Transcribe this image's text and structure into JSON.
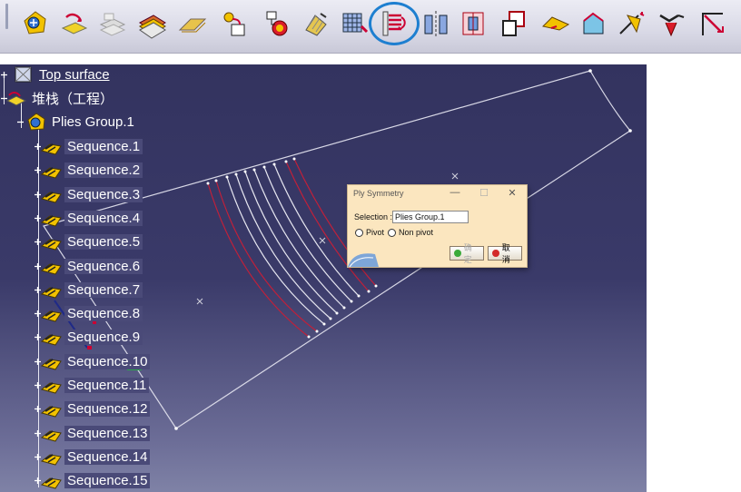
{
  "toolbar": {
    "icons": [
      "composites-param-icon",
      "stacking-icon",
      "grid-icon",
      "ply-table-icon",
      "surface-ply-icon",
      "link-ply-icon",
      "ply-exploder-icon",
      "plies-from-solid-icon",
      "core-grid-icon",
      "ply-symmetry-icon",
      "symmetry-axis-icon",
      "splice-icon",
      "cut-piece-icon",
      "flatten-icon",
      "material-excess-icon",
      "dart-icon",
      "check-icon",
      "corner-icon"
    ],
    "highlighted": "ply-symmetry-icon",
    "highlight_color": "#1e7fd0"
  },
  "tree": {
    "items": [
      {
        "label": "Top surface",
        "icon": "surface-icon"
      },
      {
        "label": "堆栈（工程）",
        "icon": "stacking-icon"
      },
      {
        "label": "Plies Group.1",
        "icon": "plies-group-icon"
      }
    ],
    "sequences": [
      "Sequence.1",
      "Sequence.2",
      "Sequence.3",
      "Sequence.4",
      "Sequence.5",
      "Sequence.6",
      "Sequence.7",
      "Sequence.8",
      "Sequence.9",
      "Sequence.10",
      "Sequence.11",
      "Sequence.12",
      "Sequence.13",
      "Sequence.14",
      "Sequence.15"
    ]
  },
  "dialog": {
    "title": "Ply Symmetry",
    "selection_label": "Selection :",
    "selection_value": "Plies Group.1",
    "radio_pivot": "Pivot",
    "radio_non_pivot": "Non pivot",
    "ok_label": "确定",
    "cancel_label": "取消",
    "minimize": "—",
    "maximize": "☐",
    "close": "✕"
  },
  "colors": {
    "viewport_top": "#33335f",
    "viewport_bottom": "#7f82a6",
    "contour_red": "#c0203a",
    "contour_white": "#e6e6f0",
    "dialog_bg": "#fbe6bf"
  }
}
